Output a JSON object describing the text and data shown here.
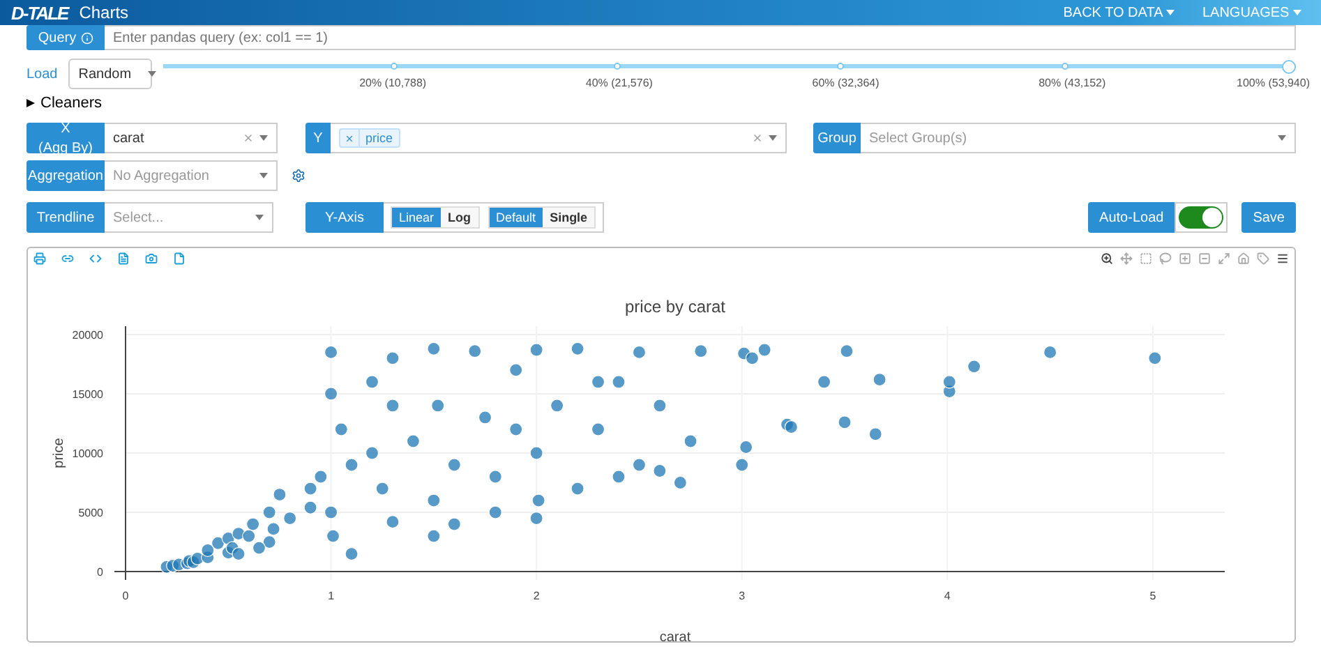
{
  "navbar": {
    "logo": "D-TALE",
    "title": "Charts",
    "menus": [
      {
        "label": "BACK TO DATA"
      },
      {
        "label": "LANGUAGES"
      }
    ]
  },
  "query": {
    "label": "Query",
    "placeholder": "Enter pandas query (ex: col1 == 1)"
  },
  "load": {
    "label": "Load",
    "value": "Random",
    "slider": {
      "level": 1.0,
      "marks": [
        "20% (10,788)",
        "40% (21,576)",
        "60% (32,364)",
        "80% (43,152)",
        "100% (53,940)"
      ]
    }
  },
  "cleaners": {
    "label": "Cleaners",
    "expanded": false
  },
  "x": {
    "label": "X",
    "sublabel": "(Agg By)",
    "value": "carat"
  },
  "y": {
    "label": "Y",
    "tags": [
      "price"
    ]
  },
  "group": {
    "label": "Group",
    "placeholder": "Select Group(s)"
  },
  "aggregation": {
    "label": "Aggregation",
    "placeholder": "No Aggregation"
  },
  "trendline": {
    "label": "Trendline",
    "placeholder": "Select..."
  },
  "y_axis": {
    "label": "Y-Axis",
    "groups": [
      [
        {
          "label": "Linear",
          "selected": true
        },
        {
          "label": "Log",
          "selected": false
        }
      ],
      [
        {
          "label": "Default",
          "selected": true
        },
        {
          "label": "Single",
          "selected": false
        }
      ]
    ]
  },
  "auto_load": {
    "label": "Auto-Load",
    "on": true
  },
  "save": {
    "label": "Save"
  },
  "chart": {
    "chart_data": {
      "type": "scatter",
      "grid": true,
      "title": "price by carat",
      "xlabel": "carat",
      "ylabel": "price",
      "xlim": [
        0,
        5.35
      ],
      "ylim": [
        -700,
        20700
      ],
      "xticks": [
        0,
        1,
        2,
        3,
        4,
        5
      ],
      "yticks": [
        0,
        5000,
        10000,
        15000,
        20000
      ],
      "x": [
        0.2,
        0.23,
        0.26,
        0.3,
        0.31,
        0.33,
        0.35,
        0.4,
        0.4,
        0.45,
        0.5,
        0.5,
        0.52,
        0.55,
        0.6,
        0.62,
        0.7,
        0.7,
        0.72,
        0.75,
        0.8,
        0.9,
        0.9,
        0.95,
        1.0,
        1.0,
        1.01,
        1.05,
        1.1,
        1.2,
        1.25,
        1.3,
        1.3,
        1.4,
        1.5,
        1.5,
        1.52,
        1.6,
        1.7,
        1.75,
        1.8,
        1.9,
        2.0,
        2.0,
        2.01,
        2.1,
        2.2,
        2.3,
        2.4,
        2.5,
        2.5,
        2.6,
        2.7,
        2.75,
        2.8,
        3.0,
        3.01,
        3.02,
        3.05,
        3.11,
        3.22,
        3.24,
        3.4,
        3.5,
        3.51,
        3.65,
        3.67,
        4.01,
        4.01,
        4.13,
        4.5,
        5.01,
        1.0,
        1.2,
        1.5,
        1.8,
        2.0,
        2.2,
        2.4,
        0.55,
        0.65,
        1.1,
        1.3,
        1.6,
        1.9,
        2.3,
        2.6
      ],
      "values": [
        400,
        500,
        600,
        700,
        900,
        800,
        1100,
        1200,
        1800,
        2400,
        1600,
        2800,
        2000,
        3200,
        3000,
        4000,
        2500,
        5000,
        3600,
        6500,
        4500,
        7000,
        5400,
        8000,
        5000,
        18500,
        3000,
        12000,
        9000,
        16000,
        7000,
        18000,
        4200,
        11000,
        6000,
        18800,
        14000,
        9000,
        18600,
        13000,
        8000,
        17000,
        10000,
        18700,
        6000,
        14000,
        18800,
        12000,
        16000,
        9000,
        18500,
        14000,
        7500,
        11000,
        18600,
        9000,
        18400,
        10500,
        18000,
        18700,
        12400,
        12200,
        16000,
        12600,
        18600,
        11600,
        16200,
        15200,
        16000,
        17300,
        18500,
        18000,
        15000,
        10000,
        3000,
        5000,
        4500,
        7000,
        8000,
        1500,
        2000,
        1500,
        14000,
        4000,
        12000,
        16000,
        8500
      ]
    }
  }
}
